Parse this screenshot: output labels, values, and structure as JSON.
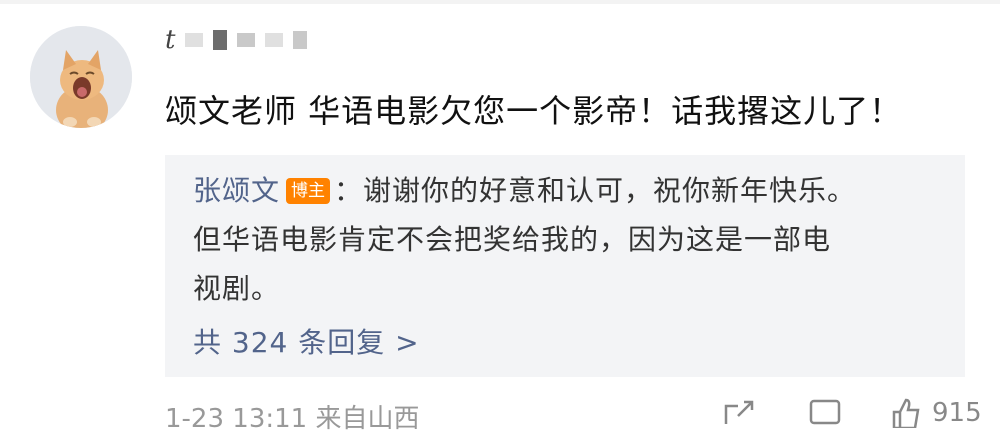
{
  "comment": {
    "username_prefix": "t",
    "text": "颂文老师 华语电影欠您一个影帝！话我撂这儿了！"
  },
  "reply": {
    "author": "张颂文",
    "badge": "博主",
    "separator": "：",
    "line1_text": "谢谢你的好意和认可，祝你新年快乐。",
    "line2_text": "但华语电影肯定不会把奖给我的，因为这是一部电",
    "line3_text": "视剧。",
    "more_replies": "共 324 条回复 >"
  },
  "footer": {
    "meta": "1-23 13:11 来自山西",
    "like_count": "915"
  },
  "colors": {
    "author_link": "#52648b",
    "badge_bg": "#ff8200",
    "reply_bg": "#f3f4f6"
  },
  "icons": [
    "share-icon",
    "comment-icon",
    "like-icon"
  ]
}
